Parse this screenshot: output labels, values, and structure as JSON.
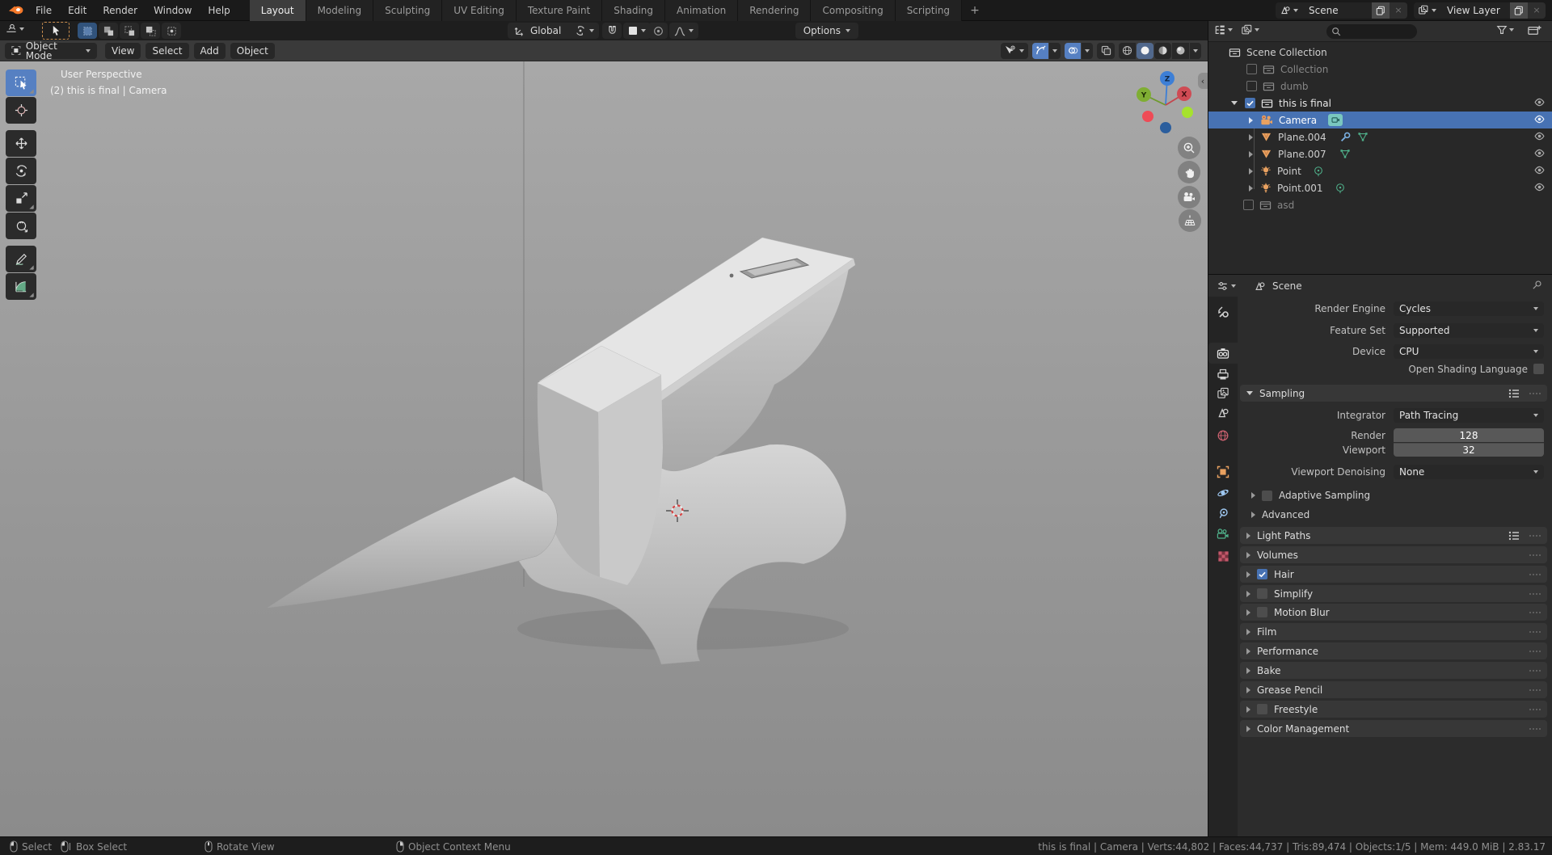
{
  "topbar": {
    "menus": [
      "File",
      "Edit",
      "Render",
      "Window",
      "Help"
    ],
    "workspaces": [
      "Layout",
      "Modeling",
      "Sculpting",
      "UV Editing",
      "Texture Paint",
      "Shading",
      "Animation",
      "Rendering",
      "Compositing",
      "Scripting"
    ],
    "add_workspace": "+",
    "scene_selector": {
      "value": "Scene"
    },
    "view_layer_selector": {
      "value": "View Layer"
    }
  },
  "tool_settings": {
    "orientation": "Global",
    "options": "Options"
  },
  "viewport": {
    "mode": "Object Mode",
    "menus": [
      "View",
      "Select",
      "Add",
      "Object"
    ],
    "overlay": {
      "view_label": "User Perspective",
      "context_label": "(2) this is final | Camera"
    },
    "gizmo": {
      "x": "X",
      "y": "Y",
      "z": "Z"
    }
  },
  "outliner": {
    "root": "Scene Collection",
    "items": [
      {
        "label": "Collection"
      },
      {
        "label": "dumb"
      },
      {
        "label": "this is final"
      },
      {
        "label": "Camera"
      },
      {
        "label": "Plane.004"
      },
      {
        "label": "Plane.007"
      },
      {
        "label": "Point"
      },
      {
        "label": "Point.001"
      },
      {
        "label": "asd"
      }
    ]
  },
  "properties": {
    "breadcrumb": "Scene",
    "render_engine": {
      "label": "Render Engine",
      "value": "Cycles"
    },
    "feature_set": {
      "label": "Feature Set",
      "value": "Supported"
    },
    "device": {
      "label": "Device",
      "value": "CPU"
    },
    "osl_label": "Open Shading Language",
    "sampling": {
      "title": "Sampling",
      "integrator_label": "Integrator",
      "integrator": "Path Tracing",
      "render_label": "Render",
      "render": "128",
      "viewport_label": "Viewport",
      "viewport": "32",
      "denoise_label": "Viewport Denoising",
      "denoise": "None",
      "adaptive": "Adaptive Sampling",
      "advanced": "Advanced"
    },
    "panels": [
      "Light Paths",
      "Volumes",
      "Hair",
      "Simplify",
      "Motion Blur",
      "Film",
      "Performance",
      "Bake",
      "Grease Pencil",
      "Freestyle",
      "Color Management"
    ]
  },
  "statusbar": {
    "hints": [
      "Select",
      "Box Select",
      "Rotate View",
      "Object Context Menu"
    ],
    "stats": "this is final | Camera | Verts:44,802 | Faces:44,737 | Tris:89,474 | Objects:1/5 | Mem: 449.0 MiB | 2.83.17"
  },
  "icons": {
    "blender-logo": "orange blender mark",
    "search-icon": "magnifier",
    "filter-icon": "funnel",
    "eye-icon": "visibility eye",
    "magnet-icon": "snap magnet",
    "camera-icon": "camera object",
    "mesh-icon": "triangle mesh",
    "light-icon": "point light",
    "wrench-icon": "modifier wrench",
    "pin-icon": "pin",
    "grip-icon": "drag dots"
  },
  "colors": {
    "accent": "#5680c2",
    "selection": "#4772b3",
    "axis_x": "#e0484f",
    "axis_y": "#7fae33",
    "axis_z": "#3d7fd6",
    "object_orange": "#e9a160",
    "data_green": "#4fb08a",
    "modifier_blue": "#7ab0e2"
  }
}
